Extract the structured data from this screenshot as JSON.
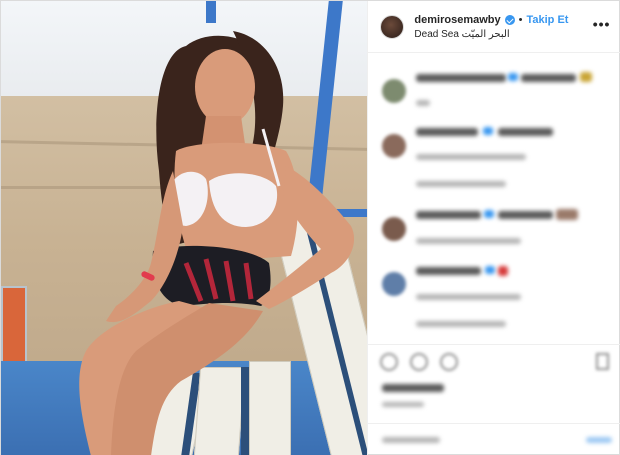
{
  "header": {
    "username": "demirosemawby",
    "follow_label": "Takip Et",
    "separator": "•",
    "location": "Dead Sea البحر الميّت",
    "more_label": "•••"
  },
  "colors": {
    "accent": "#3897f0",
    "text": "#262626",
    "border": "#dbdbdb"
  },
  "icons": [
    "verified-badge-icon",
    "more-options-icon",
    "heart-icon",
    "comment-icon",
    "share-icon",
    "bookmark-icon"
  ]
}
